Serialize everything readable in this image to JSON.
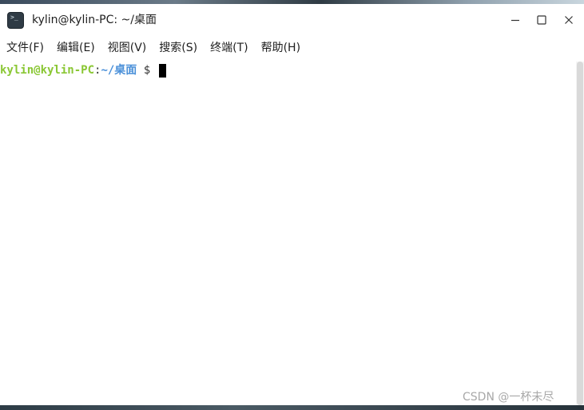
{
  "window": {
    "title": "kylin@kylin-PC: ~/桌面"
  },
  "menu": {
    "items": [
      {
        "label": "文件(F)"
      },
      {
        "label": "编辑(E)"
      },
      {
        "label": "视图(V)"
      },
      {
        "label": "搜索(S)"
      },
      {
        "label": "终端(T)"
      },
      {
        "label": "帮助(H)"
      }
    ]
  },
  "terminal": {
    "prompt_user_host": "kylin@kylin-PC",
    "prompt_colon": ":",
    "prompt_path": "~/桌面",
    "prompt_symbol": " $ ",
    "colors": {
      "user_host": "#8ac734",
      "path": "#4a90d9"
    }
  },
  "icons": {
    "app": "terminal-icon",
    "minimize": "minimize-icon",
    "maximize": "maximize-icon",
    "close": "close-icon"
  },
  "watermark": {
    "text": "CSDN @一杯未尽"
  }
}
